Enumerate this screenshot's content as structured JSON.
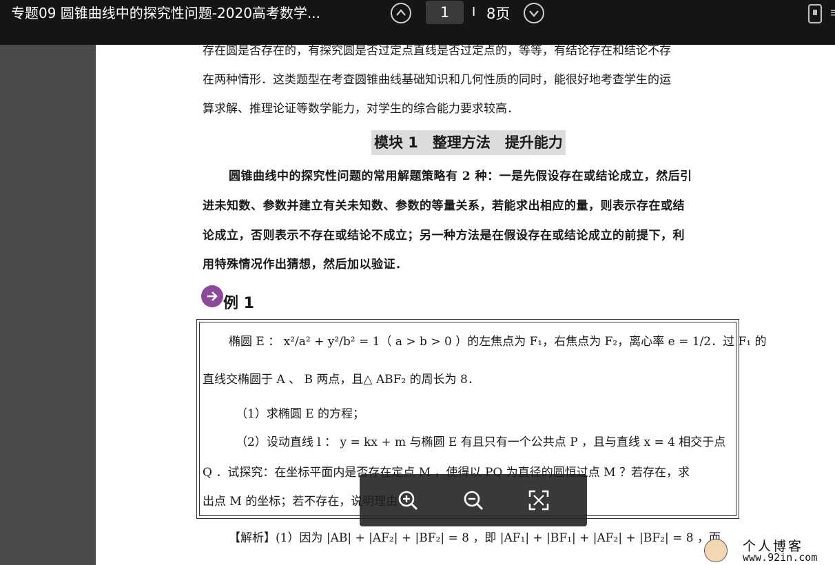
{
  "toolbar": {
    "doc_title": "专题09 圆锥曲线中的探究性问题-2020高考数学...",
    "current_page": "1",
    "page_separator": "I",
    "total_pages": "8页",
    "icons": [
      "chevron-up-icon",
      "chevron-down-icon",
      "phone-view-icon"
    ]
  },
  "document": {
    "intro_lines": [
      "存在圆是否存在的，有探究圆是否过定点直线是否过定点的，等等，有结论存在和结论不存",
      "在两种情形．这类题型在考查圆锥曲线基础知识和几何性质的同时，能很好地考查学生的运",
      "算求解、推理论证等数学能力，对学生的综合能力要求较高．"
    ],
    "module_heading": "模块 1　整理方法　提升能力",
    "strategy_lines": [
      "圆锥曲线中的探究性问题的常用解题策略有 2 种：一是先假设存在或结论成立，然后引",
      "进未知数、参数并建立有关未知数、参数的等量关系，若能求出相应的量，则表示存在或结",
      "论成立，否则表示不存在或结论不成立；另一种方法是在假设存在或结论成立的前提下，利",
      "用特殊情况作出猜想，然后加以验证．"
    ],
    "example_label": "例 1",
    "problem_lines": [
      "椭圆 E ： x²/a² + y²/b² = 1（ a > b > 0 ）的左焦点为 F₁，右焦点为 F₂，离心率 e = 1/2．过 F₁ 的",
      "直线交椭圆于 A 、 B 两点，且△ ABF₂ 的周长为 8．",
      "（1）求椭圆 E 的方程；",
      "（2）设动直线 l ： y = kx + m 与椭圆 E 有且只有一个公共点 P ，且与直线 x = 4 相交于点",
      "Q ．试探究：在坐标平面内是否存在定点 M ，使得以 PQ 为直径的圆恒过点 M ？若存在，求",
      "出点 M 的坐标；若不存在，说明理由．"
    ],
    "solution_line": "【解析】(1）因为 |AB| + |AF₂| + |BF₂| = 8 ，即 |AF₁| + |BF₁| + |AF₂| + |BF₂| = 8 ，而"
  },
  "zoom_controls": {
    "icons": [
      "zoom-in-icon",
      "zoom-out-icon",
      "fullscreen-icon"
    ]
  },
  "watermark": {
    "line1": "个人博客",
    "line2": "www.92in.com"
  }
}
